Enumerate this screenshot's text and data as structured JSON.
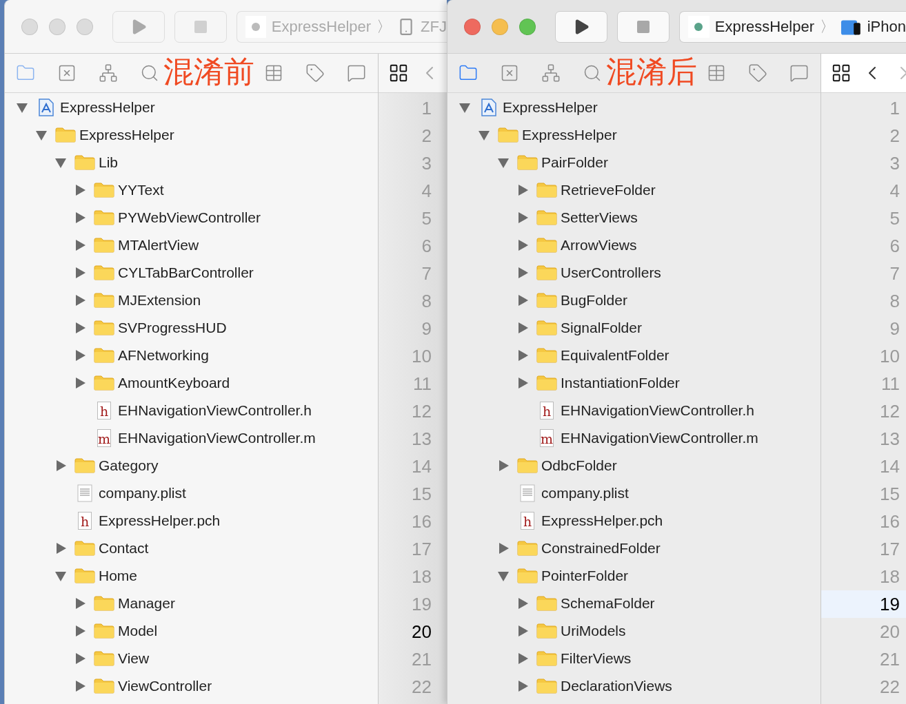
{
  "windows": [
    {
      "active": false,
      "overlay_label": "混淆前",
      "scheme": {
        "project": "ExpressHelper",
        "separator": "〉",
        "device": {
          "kind": "phone",
          "name": "ZFJ"
        }
      },
      "tree": [
        {
          "kind": "project",
          "name": "ExpressHelper",
          "expanded": true,
          "children": [
            {
              "kind": "folder",
              "name": "ExpressHelper",
              "expanded": true,
              "children": [
                {
                  "kind": "folder",
                  "name": "Lib",
                  "expanded": true,
                  "children": [
                    {
                      "kind": "folder",
                      "name": "YYText",
                      "expanded": false
                    },
                    {
                      "kind": "folder",
                      "name": "PYWebViewController",
                      "expanded": false
                    },
                    {
                      "kind": "folder",
                      "name": "MTAlertView",
                      "expanded": false
                    },
                    {
                      "kind": "folder",
                      "name": "CYLTabBarController",
                      "expanded": false
                    },
                    {
                      "kind": "folder",
                      "name": "MJExtension",
                      "expanded": false
                    },
                    {
                      "kind": "folder",
                      "name": "SVProgressHUD",
                      "expanded": false
                    },
                    {
                      "kind": "folder",
                      "name": "AFNetworking",
                      "expanded": false
                    },
                    {
                      "kind": "folder",
                      "name": "AmountKeyboard",
                      "expanded": false
                    },
                    {
                      "kind": "source",
                      "letter": "h",
                      "name": "EHNavigationViewController.h"
                    },
                    {
                      "kind": "source",
                      "letter": "m",
                      "name": "EHNavigationViewController.m"
                    }
                  ]
                },
                {
                  "kind": "folder",
                  "name": "Gategory",
                  "expanded": false
                },
                {
                  "kind": "plist",
                  "name": "company.plist"
                },
                {
                  "kind": "source",
                  "letter": "h",
                  "name": "ExpressHelper.pch"
                },
                {
                  "kind": "folder",
                  "name": "Contact",
                  "expanded": false
                },
                {
                  "kind": "folder",
                  "name": "Home",
                  "expanded": true,
                  "children": [
                    {
                      "kind": "folder",
                      "name": "Manager",
                      "expanded": false
                    },
                    {
                      "kind": "folder",
                      "name": "Model",
                      "expanded": false
                    },
                    {
                      "kind": "folder",
                      "name": "View",
                      "expanded": false
                    },
                    {
                      "kind": "folder",
                      "name": "ViewController",
                      "expanded": false
                    }
                  ]
                }
              ]
            }
          ]
        }
      ],
      "line_numbers": [
        {
          "text": "1",
          "selected": false
        },
        {
          "text": "2",
          "selected": false
        },
        {
          "text": "3",
          "selected": false
        },
        {
          "text": "4",
          "selected": false
        },
        {
          "text": "5",
          "selected": false
        },
        {
          "text": "6",
          "selected": false
        },
        {
          "text": "7",
          "selected": false
        },
        {
          "text": "8",
          "selected": false
        },
        {
          "text": "9",
          "selected": false
        },
        {
          "text": "10",
          "selected": false
        },
        {
          "text": "11",
          "selected": false
        },
        {
          "text": "12",
          "selected": false
        },
        {
          "text": "13",
          "selected": false
        },
        {
          "text": "14",
          "selected": false
        },
        {
          "text": "15",
          "selected": false
        },
        {
          "text": "16",
          "selected": false
        },
        {
          "text": "17",
          "selected": false
        },
        {
          "text": "18",
          "selected": false
        },
        {
          "text": "19",
          "selected": false
        },
        {
          "text": "20",
          "selected": true
        },
        {
          "text": "21",
          "selected": false
        },
        {
          "text": "22",
          "selected": false
        }
      ]
    },
    {
      "active": true,
      "overlay_label": "混淆后",
      "scheme": {
        "project": "ExpressHelper",
        "separator": "〉",
        "device": {
          "kind": "simulator",
          "name": "iPhon"
        }
      },
      "tree": [
        {
          "kind": "project",
          "name": "ExpressHelper",
          "expanded": true,
          "children": [
            {
              "kind": "folder",
              "name": "ExpressHelper",
              "expanded": true,
              "children": [
                {
                  "kind": "folder",
                  "name": "PairFolder",
                  "expanded": true,
                  "children": [
                    {
                      "kind": "folder",
                      "name": "RetrieveFolder",
                      "expanded": false
                    },
                    {
                      "kind": "folder",
                      "name": "SetterViews",
                      "expanded": false
                    },
                    {
                      "kind": "folder",
                      "name": "ArrowViews",
                      "expanded": false
                    },
                    {
                      "kind": "folder",
                      "name": "UserControllers",
                      "expanded": false
                    },
                    {
                      "kind": "folder",
                      "name": "BugFolder",
                      "expanded": false
                    },
                    {
                      "kind": "folder",
                      "name": "SignalFolder",
                      "expanded": false
                    },
                    {
                      "kind": "folder",
                      "name": "EquivalentFolder",
                      "expanded": false
                    },
                    {
                      "kind": "folder",
                      "name": "InstantiationFolder",
                      "expanded": false
                    },
                    {
                      "kind": "source",
                      "letter": "h",
                      "name": "EHNavigationViewController.h"
                    },
                    {
                      "kind": "source",
                      "letter": "m",
                      "name": "EHNavigationViewController.m"
                    }
                  ]
                },
                {
                  "kind": "folder",
                  "name": "OdbcFolder",
                  "expanded": false
                },
                {
                  "kind": "plist",
                  "name": "company.plist"
                },
                {
                  "kind": "source",
                  "letter": "h",
                  "name": "ExpressHelper.pch"
                },
                {
                  "kind": "folder",
                  "name": "ConstrainedFolder",
                  "expanded": false
                },
                {
                  "kind": "folder",
                  "name": "PointerFolder",
                  "expanded": true,
                  "children": [
                    {
                      "kind": "folder",
                      "name": "SchemaFolder",
                      "expanded": false
                    },
                    {
                      "kind": "folder",
                      "name": "UriModels",
                      "expanded": false
                    },
                    {
                      "kind": "folder",
                      "name": "FilterViews",
                      "expanded": false
                    },
                    {
                      "kind": "folder",
                      "name": "DeclarationViews",
                      "expanded": false
                    }
                  ]
                }
              ]
            }
          ]
        }
      ],
      "line_numbers": [
        {
          "text": "1",
          "selected": false
        },
        {
          "text": "2",
          "selected": false
        },
        {
          "text": "3",
          "selected": false
        },
        {
          "text": "4",
          "selected": false
        },
        {
          "text": "5",
          "selected": false
        },
        {
          "text": "6",
          "selected": false
        },
        {
          "text": "7",
          "selected": false
        },
        {
          "text": "8",
          "selected": false
        },
        {
          "text": "9",
          "selected": false
        },
        {
          "text": "10",
          "selected": false
        },
        {
          "text": "11",
          "selected": false
        },
        {
          "text": "12",
          "selected": false
        },
        {
          "text": "13",
          "selected": false
        },
        {
          "text": "14",
          "selected": false
        },
        {
          "text": "15",
          "selected": false
        },
        {
          "text": "16",
          "selected": false
        },
        {
          "text": "17",
          "selected": false
        },
        {
          "text": "18",
          "selected": false
        },
        {
          "text": "19",
          "selected": true
        },
        {
          "text": "20",
          "selected": false
        },
        {
          "text": "21",
          "selected": false
        },
        {
          "text": "22",
          "selected": false
        }
      ]
    }
  ]
}
